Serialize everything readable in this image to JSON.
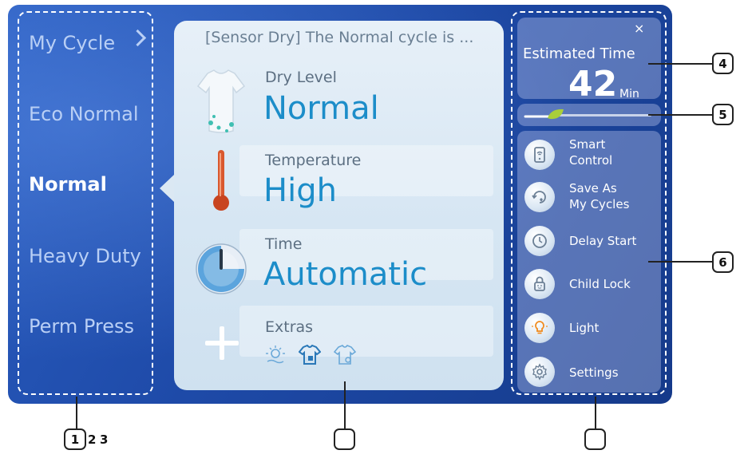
{
  "cycles": {
    "items": [
      {
        "label": "My Cycle"
      },
      {
        "label": "Eco Normal"
      },
      {
        "label": "Normal"
      },
      {
        "label": "Heavy Duty"
      },
      {
        "label": "Perm Press"
      }
    ],
    "active": "Normal"
  },
  "panel": {
    "title": "[Sensor Dry] The Normal cycle is ...",
    "dry_level_label": "Dry Level",
    "dry_level_value": "Normal",
    "temperature_label": "Temperature",
    "temperature_value": "High",
    "time_label": "Time",
    "time_value": "Automatic",
    "extras_label": "Extras"
  },
  "estimated": {
    "label": "Estimated Time",
    "value": "42",
    "unit": "Min",
    "close": "×"
  },
  "progress": {
    "value": 0.0
  },
  "side_menu": [
    {
      "label": "Smart\nControl",
      "icon": "smart-control-icon"
    },
    {
      "label": "Save As\nMy Cycles",
      "icon": "save-cycle-icon"
    },
    {
      "label": "Delay Start",
      "icon": "delay-start-icon"
    },
    {
      "label": "Child Lock",
      "icon": "child-lock-icon"
    },
    {
      "label": "Light",
      "icon": "light-icon"
    },
    {
      "label": "Settings",
      "icon": "settings-icon"
    }
  ],
  "callouts": {
    "c1": "1",
    "c2": "2",
    "c3": "3",
    "c4": "4",
    "c5": "5",
    "c6": "6",
    "c_mid": "",
    "c_right": ""
  },
  "colors": {
    "screen": "#1e4aa8",
    "accent": "#1c8dc9"
  }
}
